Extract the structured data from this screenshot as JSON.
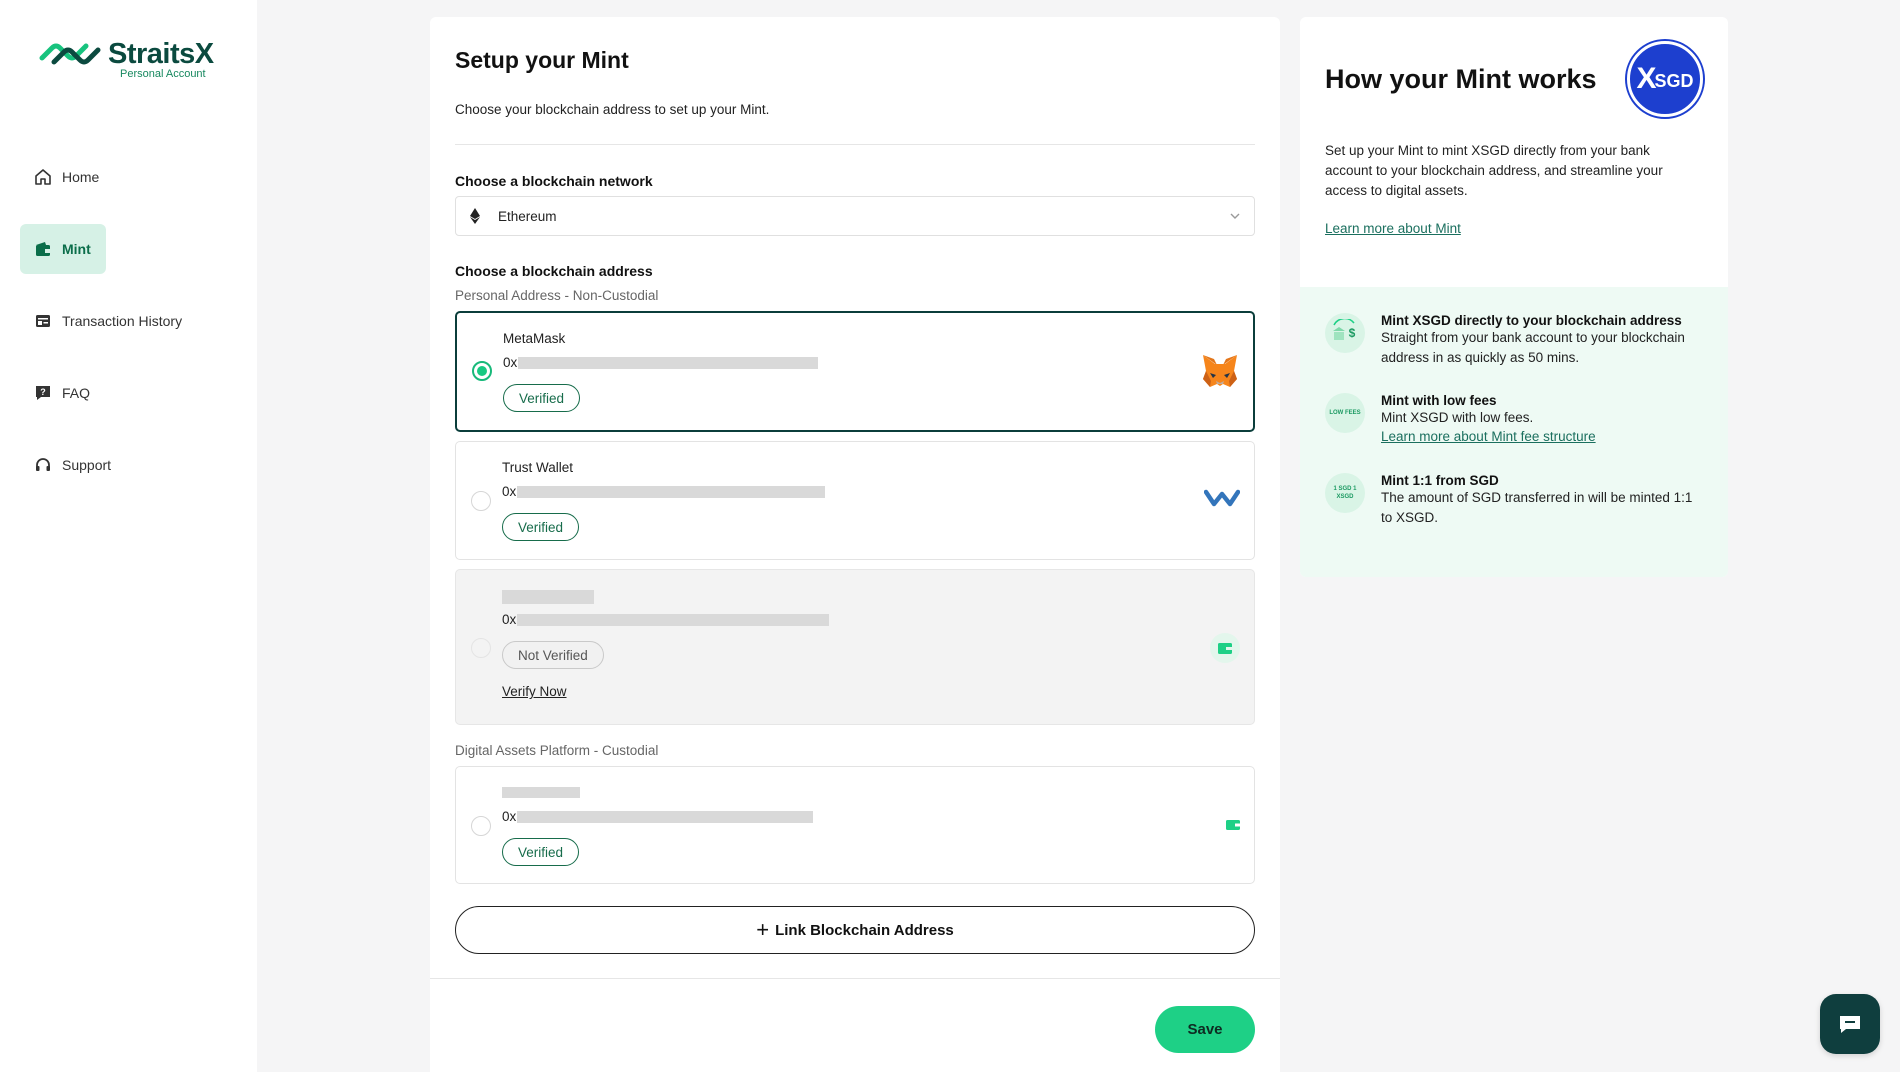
{
  "brand": {
    "name": "StraitsX",
    "subtitle": "Personal Account",
    "accent": "#1ed086",
    "dark": "#0b3e3b"
  },
  "sidebar": {
    "items": [
      {
        "label": "Home",
        "icon": "home-icon",
        "active": false
      },
      {
        "label": "Mint",
        "icon": "wallet-icon",
        "active": true
      },
      {
        "label": "Transaction History",
        "icon": "history-icon",
        "active": false
      },
      {
        "label": "FAQ",
        "icon": "question-icon",
        "active": false
      },
      {
        "label": "Support",
        "icon": "headset-icon",
        "active": false
      }
    ]
  },
  "setup": {
    "title": "Setup your Mint",
    "subtitle": "Choose your blockchain address to set up your Mint.",
    "network_label": "Choose a blockchain network",
    "network_value": "Ethereum",
    "address_label": "Choose a blockchain address",
    "personal_group": "Personal Address - Non-Custodial",
    "custodial_group": "Digital Assets Platform - Custodial",
    "wallets": [
      {
        "name": "MetaMask",
        "prefix": "0x",
        "status": "Verified",
        "selected": true,
        "icon": "metamask-fox-icon"
      },
      {
        "name": "Trust Wallet",
        "prefix": "0x",
        "status": "Verified",
        "selected": false,
        "icon": "trust-wallet-icon"
      },
      {
        "name": "",
        "prefix": "0x",
        "status": "Not Verified",
        "selected": false,
        "action": "Verify Now",
        "icon": "generic-wallet-icon"
      },
      {
        "name": "",
        "prefix": "0x",
        "status": "Verified",
        "selected": false,
        "icon": "generic-wallet-icon"
      }
    ],
    "link_button": "Link Blockchain Address",
    "save_button": "Save"
  },
  "info": {
    "title": "How your Mint works",
    "badge": {
      "x": "X",
      "rest": "SGD"
    },
    "description": "Set up your Mint to mint XSGD directly from your bank account to your blockchain address, and streamline your access to digital assets.",
    "learn_more": "Learn more about Mint",
    "features": [
      {
        "title": "Mint XSGD directly to your blockchain address",
        "text": "Straight from your bank account to your blockchain address in as quickly as 50 mins.",
        "icon": "bank-to-dollar-icon"
      },
      {
        "title": "Mint with low fees",
        "text": "Mint XSGD with low fees.",
        "link": "Learn more about Mint fee structure",
        "icon": "low-fees-icon",
        "icon_text": "LOW FEES"
      },
      {
        "title": "Mint 1:1 from SGD",
        "text": "The amount of SGD transferred in will be minted 1:1 to XSGD.",
        "icon": "sgd-xsgd-icon",
        "icon_text": "1 SGD 1 XSGD"
      }
    ]
  }
}
